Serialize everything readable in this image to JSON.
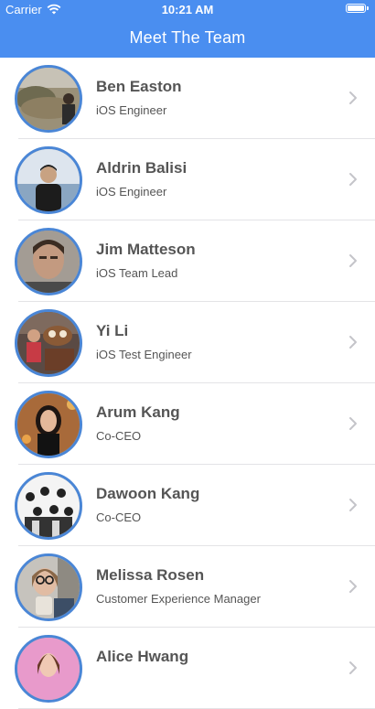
{
  "status_bar": {
    "carrier": "Carrier",
    "time": "10:21 AM"
  },
  "nav": {
    "title": "Meet The Team"
  },
  "colors": {
    "header": "#4a8ef0",
    "avatar_border": "#4a86d6",
    "text": "#555555"
  },
  "team": [
    {
      "name": "Ben Easton",
      "role": "iOS Engineer"
    },
    {
      "name": "Aldrin Balisi",
      "role": "iOS Engineer"
    },
    {
      "name": "Jim Matteson",
      "role": "iOS Team Lead"
    },
    {
      "name": "Yi Li",
      "role": "iOS Test Engineer"
    },
    {
      "name": "Arum Kang",
      "role": "Co-CEO"
    },
    {
      "name": "Dawoon Kang",
      "role": "Co-CEO"
    },
    {
      "name": "Melissa Rosen",
      "role": "Customer Experience Manager"
    },
    {
      "name": "Alice Hwang",
      "role": ""
    }
  ]
}
